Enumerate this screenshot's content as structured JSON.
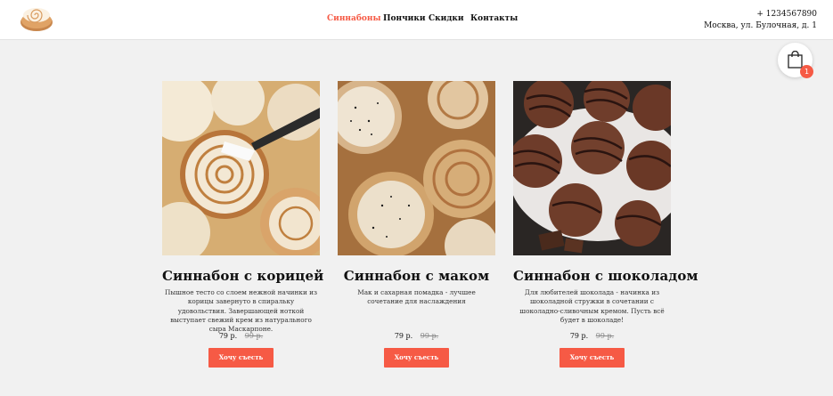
{
  "nav": {
    "items": [
      "Синнабоны",
      "Пончики",
      "Скидки",
      "Контакты"
    ],
    "active_color": "#f65a45"
  },
  "contact": {
    "phone": "+ 1234567890",
    "address": "Москва, ул. Булочная, д. 1"
  },
  "cart": {
    "icon": "shopping-bag-icon",
    "count": "1"
  },
  "colors": {
    "accent": "#f65a45",
    "background": "#f1f1f1"
  },
  "products": [
    {
      "title": "Синнабон с корицей",
      "description": "Пышное тесто со слоем нежной начинки из корицы завернуто в спиральку удовольствия. Завершающей ноткой выступает свежий крем из натурального сыра Маскарпоне.",
      "price": "79 р.",
      "old_price": "99 р.",
      "button": "Хочу съесть"
    },
    {
      "title": "Синнабон с маком",
      "description": "Мак и сахарная помадка - лучшее сочетание для наслаждения",
      "price": "79 р.",
      "old_price": "99 р.",
      "button": "Хочу съесть"
    },
    {
      "title": "Синнабон с шоколадом",
      "description": "Для любителей шоколада - начинка из шоколадной стружки в сочетании с шоколадно-сливочным кремом. Пусть всё будет в шоколаде!",
      "price": "79 р.",
      "old_price": "99 р.",
      "button": "Хочу съесть"
    }
  ]
}
